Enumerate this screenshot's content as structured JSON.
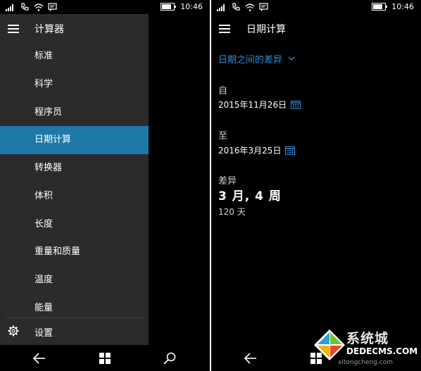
{
  "status_bar": {
    "time": "10:46"
  },
  "left": {
    "app_title": "计算器",
    "menu_items": [
      "标准",
      "科学",
      "程序员",
      "日期计算",
      "转换器",
      "体积",
      "长度",
      "重量和质量",
      "温度",
      "能量"
    ],
    "selected_index": 3,
    "settings_label": "设置"
  },
  "right": {
    "title": "日期计算",
    "mode": "日期之间的差异",
    "from_label": "自",
    "from_date": "2015年11月26日",
    "to_label": "至",
    "to_date": "2016年3月25日",
    "diff_label": "差异",
    "diff_result": "3 月, 4 周",
    "diff_days": "120 天"
  },
  "watermark": {
    "brand": "系统城",
    "url": "DEDECMS.COM",
    "url2": "xitongcheng.com"
  },
  "colors": {
    "accent": "#1e78a8",
    "link": "#2d8fd8",
    "pane": "#2b2b2b",
    "background": "#000000"
  }
}
